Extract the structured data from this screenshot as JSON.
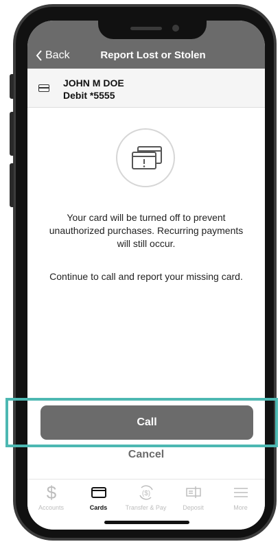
{
  "nav": {
    "back_label": "Back",
    "title": "Report Lost or Stolen"
  },
  "card": {
    "holder": "JOHN M DOE",
    "number": "Debit *5555"
  },
  "message": {
    "line1": "Your card will be turned off to prevent unauthorized purchases. Recurring payments will still occur.",
    "line2": "Continue to call and report your missing card."
  },
  "actions": {
    "call_label": "Call",
    "cancel_label": "Cancel"
  },
  "tabs": [
    {
      "label": "Accounts",
      "icon": "dollar-icon",
      "active": false
    },
    {
      "label": "Cards",
      "icon": "card-icon",
      "active": true
    },
    {
      "label": "Transfer & Pay",
      "icon": "transfer-icon",
      "active": false
    },
    {
      "label": "Deposit",
      "icon": "deposit-icon",
      "active": false
    },
    {
      "label": "More",
      "icon": "menu-icon",
      "active": false
    }
  ],
  "colors": {
    "nav": "#6b6b6b",
    "highlight": "#4db8b2",
    "inactive_tab": "#bdbdbd"
  }
}
